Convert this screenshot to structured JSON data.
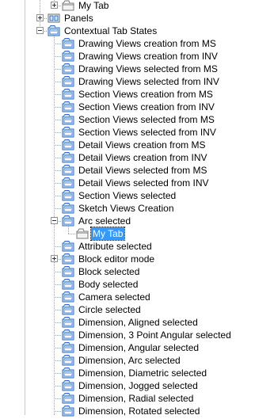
{
  "rows": [
    {
      "label": "My Tab",
      "icon": "tab-folder-icon",
      "depth": 2,
      "expander": "plus",
      "selected": false
    },
    {
      "label": "Panels",
      "icon": "panels-icon",
      "depth": 1,
      "expander": "plus",
      "selected": false
    },
    {
      "label": "Contextual Tab States",
      "icon": "contextual-tab-states-icon",
      "depth": 1,
      "expander": "minus",
      "selected": false
    },
    {
      "label": "Drawing Views creation from MS",
      "icon": "contextual-state-icon",
      "depth": 2,
      "expander": "",
      "selected": false
    },
    {
      "label": "Drawing Views creation from INV",
      "icon": "contextual-state-icon",
      "depth": 2,
      "expander": "",
      "selected": false
    },
    {
      "label": "Drawing Views selected from MS",
      "icon": "contextual-state-icon",
      "depth": 2,
      "expander": "",
      "selected": false
    },
    {
      "label": "Drawing Views selected from INV",
      "icon": "contextual-state-icon",
      "depth": 2,
      "expander": "",
      "selected": false
    },
    {
      "label": "Section Views creation from MS",
      "icon": "contextual-state-icon",
      "depth": 2,
      "expander": "",
      "selected": false
    },
    {
      "label": "Section Views creation from INV",
      "icon": "contextual-state-icon",
      "depth": 2,
      "expander": "",
      "selected": false
    },
    {
      "label": "Section Views selected from MS",
      "icon": "contextual-state-icon",
      "depth": 2,
      "expander": "",
      "selected": false
    },
    {
      "label": "Section Views selected from INV",
      "icon": "contextual-state-icon",
      "depth": 2,
      "expander": "",
      "selected": false
    },
    {
      "label": "Detail Views creation from MS",
      "icon": "contextual-state-icon",
      "depth": 2,
      "expander": "",
      "selected": false
    },
    {
      "label": "Detail Views creation from INV",
      "icon": "contextual-state-icon",
      "depth": 2,
      "expander": "",
      "selected": false
    },
    {
      "label": "Detail Views selected from MS",
      "icon": "contextual-state-icon",
      "depth": 2,
      "expander": "",
      "selected": false
    },
    {
      "label": "Detail Views selected from INV",
      "icon": "contextual-state-icon",
      "depth": 2,
      "expander": "",
      "selected": false
    },
    {
      "label": "Section Views selected",
      "icon": "contextual-state-icon",
      "depth": 2,
      "expander": "",
      "selected": false
    },
    {
      "label": "Sketch Views Creation",
      "icon": "contextual-state-icon",
      "depth": 2,
      "expander": "",
      "selected": false
    },
    {
      "label": "Arc selected",
      "icon": "contextual-state-icon",
      "depth": 2,
      "expander": "minus",
      "selected": false
    },
    {
      "label": "My Tab",
      "icon": "tab-folder-icon",
      "depth": 3,
      "expander": "",
      "selected": true
    },
    {
      "label": "Attribute selected",
      "icon": "contextual-state-icon",
      "depth": 2,
      "expander": "",
      "selected": false
    },
    {
      "label": "Block editor mode",
      "icon": "contextual-state-icon",
      "depth": 2,
      "expander": "plus",
      "selected": false
    },
    {
      "label": "Block selected",
      "icon": "contextual-state-icon",
      "depth": 2,
      "expander": "",
      "selected": false
    },
    {
      "label": "Body selected",
      "icon": "contextual-state-icon",
      "depth": 2,
      "expander": "",
      "selected": false
    },
    {
      "label": "Camera selected",
      "icon": "contextual-state-icon",
      "depth": 2,
      "expander": "",
      "selected": false
    },
    {
      "label": "Circle selected",
      "icon": "contextual-state-icon",
      "depth": 2,
      "expander": "",
      "selected": false
    },
    {
      "label": "Dimension, Aligned selected",
      "icon": "contextual-state-icon",
      "depth": 2,
      "expander": "",
      "selected": false
    },
    {
      "label": "Dimension, 3 Point Angular selected",
      "icon": "contextual-state-icon",
      "depth": 2,
      "expander": "",
      "selected": false
    },
    {
      "label": "Dimension, Angular selected",
      "icon": "contextual-state-icon",
      "depth": 2,
      "expander": "",
      "selected": false
    },
    {
      "label": "Dimension, Arc selected",
      "icon": "contextual-state-icon",
      "depth": 2,
      "expander": "",
      "selected": false
    },
    {
      "label": "Dimension, Diametric selected",
      "icon": "contextual-state-icon",
      "depth": 2,
      "expander": "",
      "selected": false
    },
    {
      "label": "Dimension, Jogged selected",
      "icon": "contextual-state-icon",
      "depth": 2,
      "expander": "",
      "selected": false
    },
    {
      "label": "Dimension, Radial selected",
      "icon": "contextual-state-icon",
      "depth": 2,
      "expander": "",
      "selected": false
    },
    {
      "label": "Dimension, Rotated selected",
      "icon": "contextual-state-icon",
      "depth": 2,
      "expander": "",
      "selected": false
    }
  ],
  "colors": {
    "selection_bg": "#3399ff",
    "selection_text": "#ffffff",
    "tree_line": "#a0a0a0",
    "icon_blue": "#2a6cc4",
    "icon_light": "#cfe3f7",
    "folder_fill": "#f3f3f3",
    "folder_stroke": "#7a7a7a"
  }
}
